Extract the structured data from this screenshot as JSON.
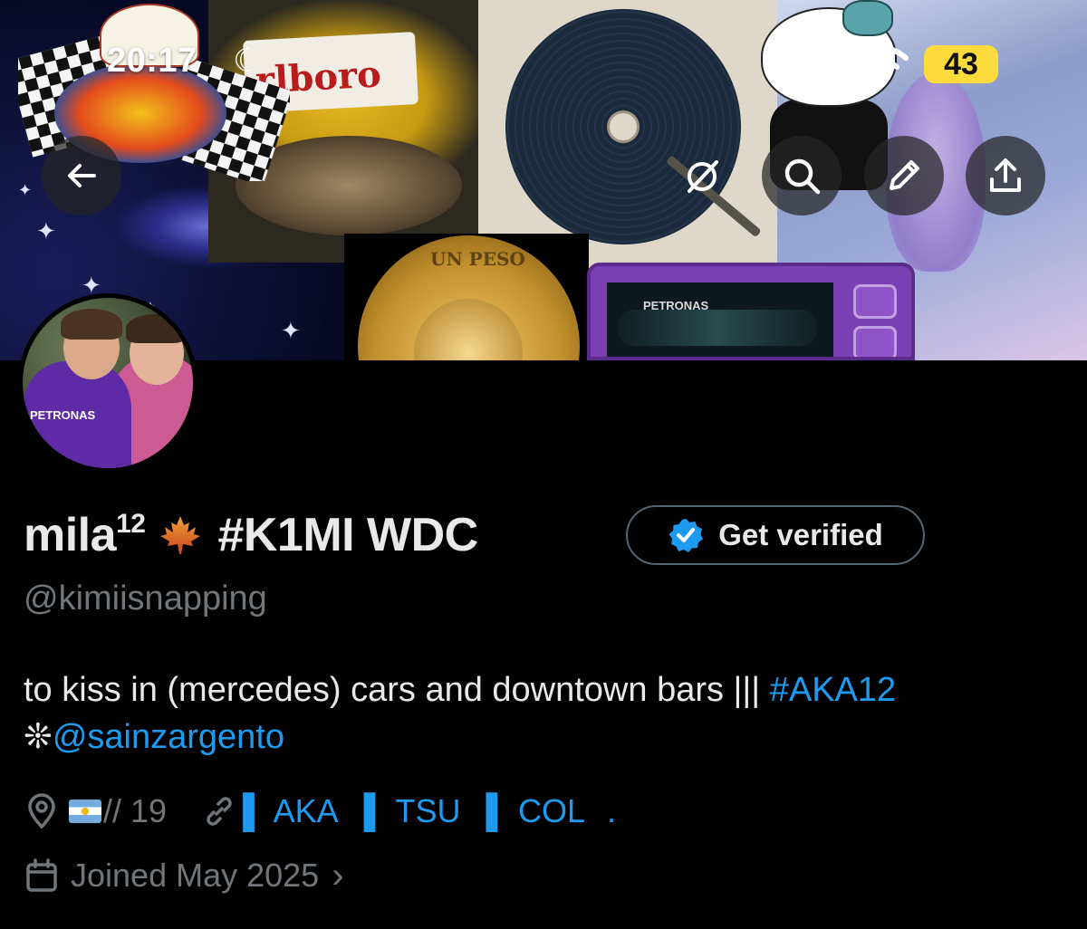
{
  "status_bar": {
    "time": "20:17",
    "battery": "43"
  },
  "banner": {
    "helmet_text": "rlboro",
    "coin_text": "UN PESO",
    "camera_text": "PETRONAS",
    "avatar_text": "PETRONAS"
  },
  "header_actions": {
    "back_icon": "arrow-left-icon",
    "grok_icon": "grok-icon",
    "search_icon": "search-icon",
    "edit_icon": "pencil-icon",
    "share_icon": "share-icon"
  },
  "profile": {
    "display_name": "mila",
    "name_superscript": "12",
    "name_tag": "#K1MI WDC",
    "verify_button": "Get verified",
    "handle": "@kimiisnapping",
    "bio_text": "to kiss in (mercedes) cars and downtown bars ||| ",
    "bio_hashtag": "#AKA12",
    "bio_prefix_symbol": "❊",
    "bio_mention": "@sainzargento",
    "location": "// 19",
    "website_parts": [
      "▌ AKA",
      "▌ TSU",
      "▌ COL",
      "."
    ],
    "joined": "Joined May 2025",
    "joined_chevron": "›"
  },
  "colors": {
    "background": "#000000",
    "text_primary": "#e7e9ea",
    "text_secondary": "#71767b",
    "accent": "#1d9bf0",
    "border": "#536471",
    "battery": "#fedb3c"
  }
}
